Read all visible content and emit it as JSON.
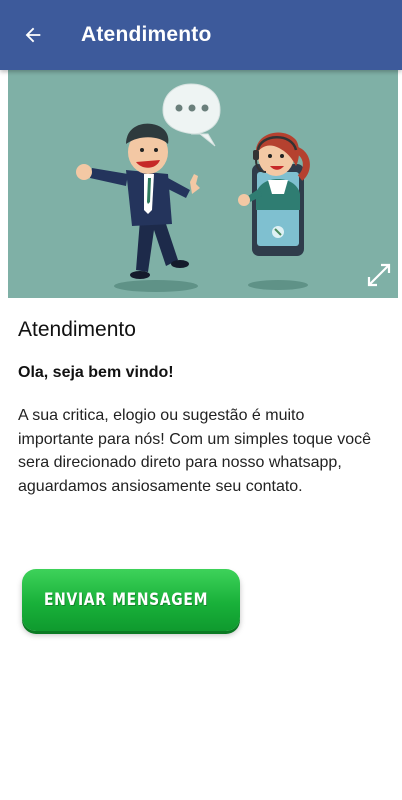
{
  "colors": {
    "appbar": "#3d5a9b",
    "hero_background": "#7fb0a6",
    "whatsapp_green": "#19b13a"
  },
  "appbar": {
    "back_icon": "arrow-left-icon",
    "title": "Atendimento"
  },
  "hero": {
    "illustration": "customer-service-illustration",
    "expand_icon": "expand-icon"
  },
  "content": {
    "title": "Atendimento",
    "greeting": "Ola, seja bem vindo!",
    "body": "A sua critica, elogio ou sugestão é muito importante para nós! Com um simples toque você sera direcionado direto para nosso whatsapp, aguardamos ansiosamente seu contato."
  },
  "whatsapp_button": {
    "icon": "whatsapp-icon",
    "label": "ENVIAR MENSAGEM"
  }
}
